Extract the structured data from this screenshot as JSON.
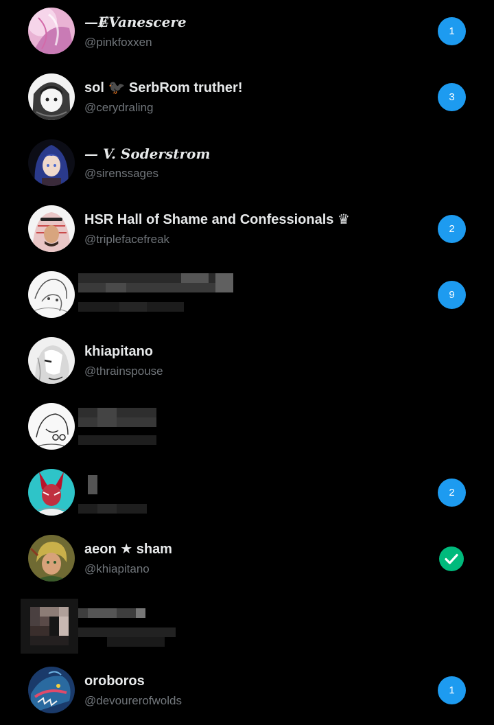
{
  "conversations": [
    {
      "name": "—Ɇ̶Vanescere",
      "handle": "@pinkfoxxen",
      "unread": "1",
      "avatar": "pink-anime-girl-avatar"
    },
    {
      "name": "sol 🐦‍⬛ SerbRom truther!",
      "handle": "@cerydraling",
      "unread": "3",
      "avatar": "manga-girl-avatar"
    },
    {
      "name": "— V. Soderstrom",
      "handle": "@sirenssages",
      "unread": "",
      "avatar": "blue-hair-girl-avatar"
    },
    {
      "name": "HSR Hall of Shame and Confessionals ♛",
      "handle": "@triplefacefreak",
      "unread": "2",
      "avatar": "keffiyeh-man-avatar"
    },
    {
      "name": "",
      "handle": "",
      "unread": "9",
      "avatar": "sketch-avatar",
      "redacted": true
    },
    {
      "name": "khiapitano",
      "handle": "@thrainspouse",
      "unread": "",
      "avatar": "white-hair-sketch-avatar"
    },
    {
      "name": "",
      "handle": "",
      "unread": "",
      "avatar": "line-art-avatar",
      "redacted": true
    },
    {
      "name": "",
      "handle": "",
      "unread": "2",
      "avatar": "red-mask-avatar",
      "redacted": true
    },
    {
      "name": "aeon ★ sham",
      "handle": "@khiapitano",
      "status": "verified-check",
      "avatar": "blond-warrior-avatar"
    },
    {
      "name": "",
      "handle": "",
      "unread": "",
      "avatar": "redacted-avatar",
      "redacted": true
    },
    {
      "name": "oroboros",
      "handle": "@devourerofwolds",
      "unread": "1",
      "avatar": "blue-dragon-avatar"
    }
  ],
  "colors": {
    "background": "#000000",
    "name": "#e7e9ea",
    "handle": "#71767b",
    "badge": "#1d9bf0",
    "check": "#00ba7c"
  }
}
